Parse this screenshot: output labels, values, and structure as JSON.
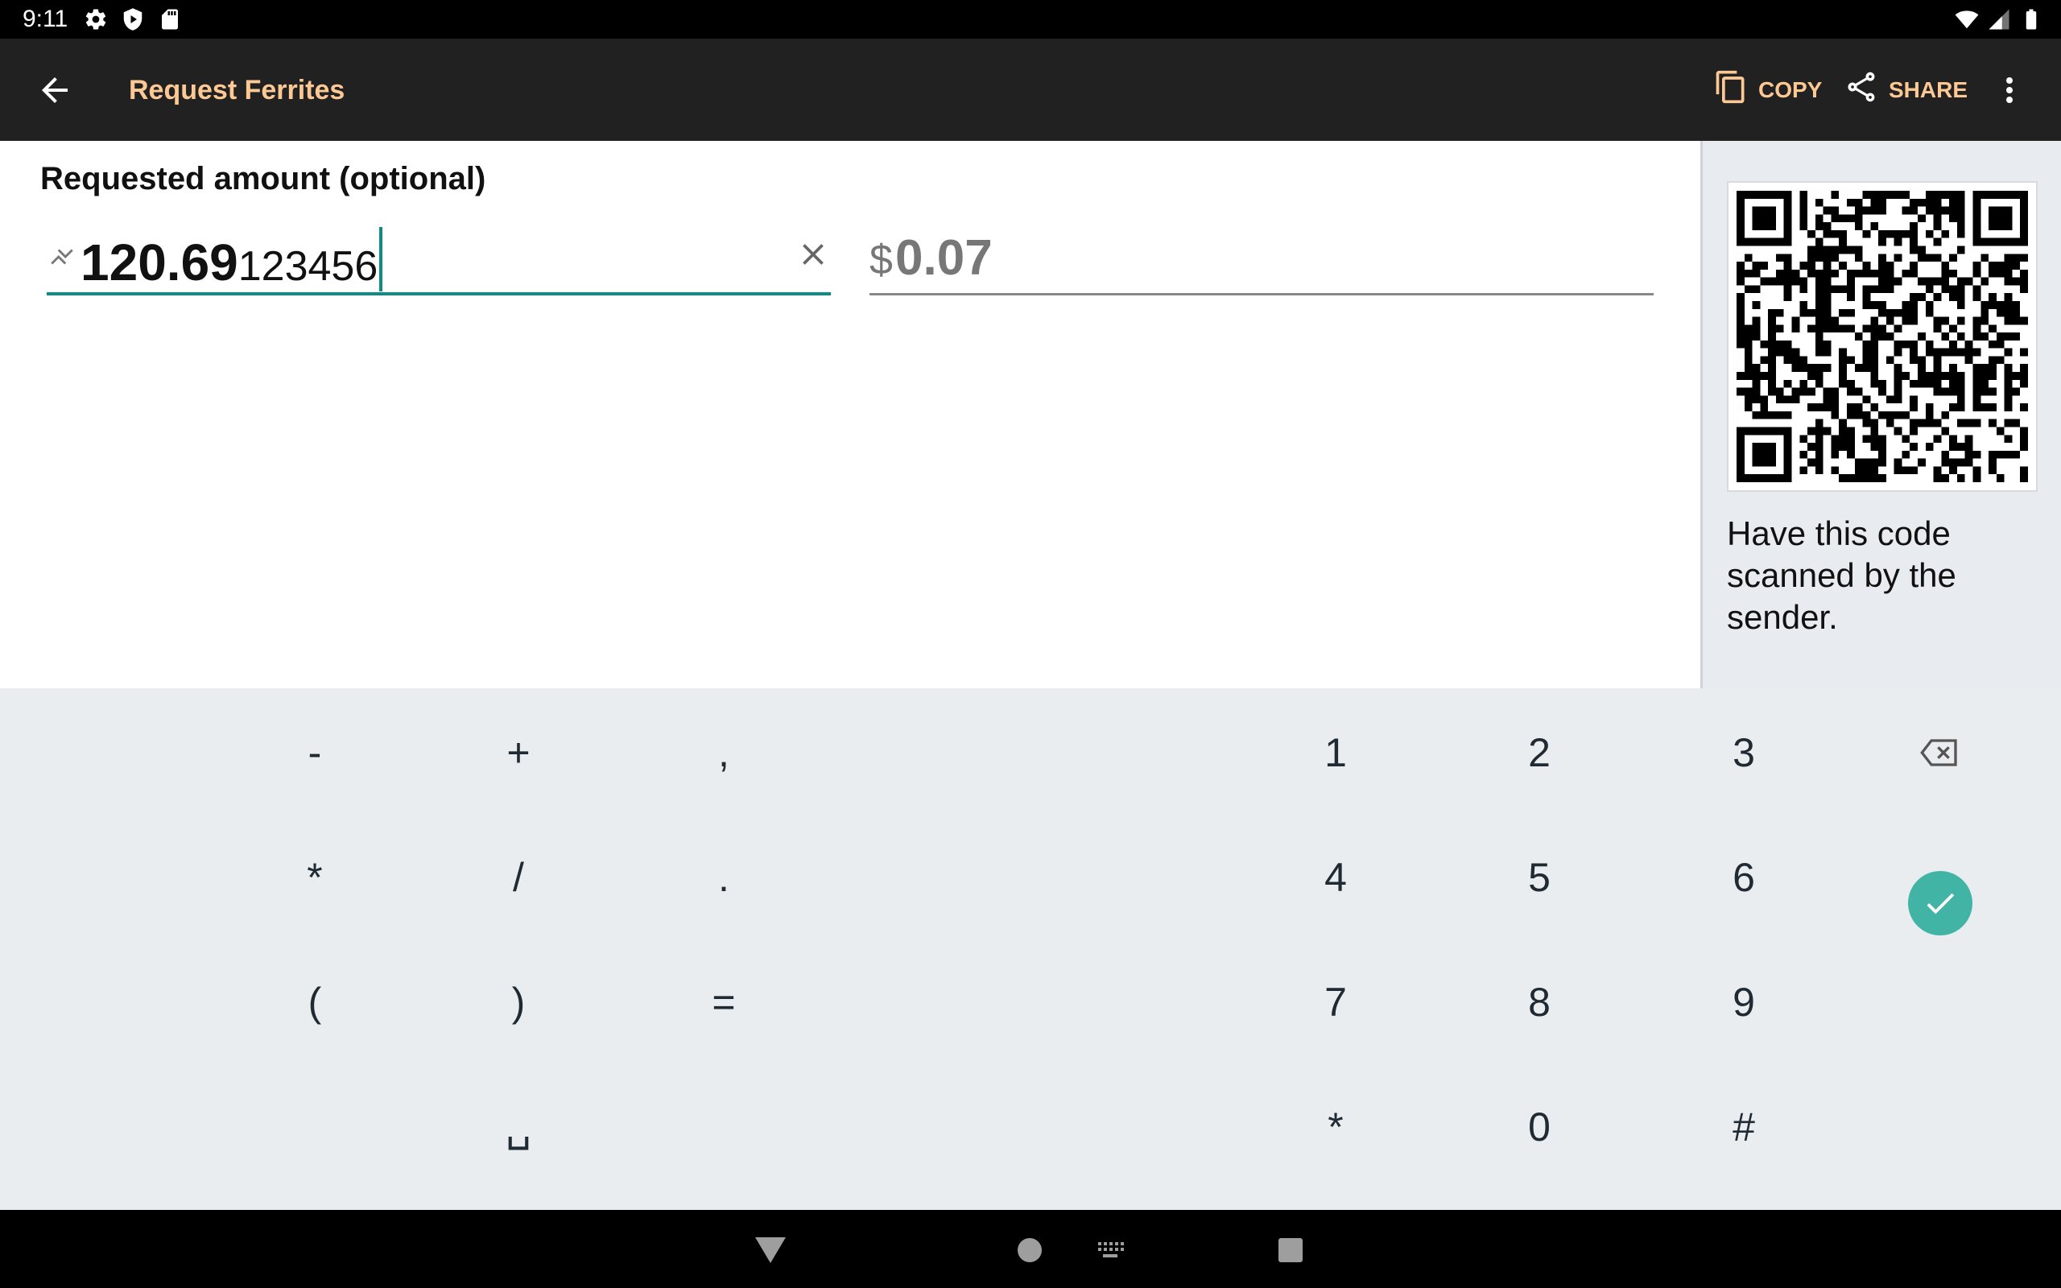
{
  "status_bar": {
    "time": "9:11",
    "left_icons": [
      "settings-icon",
      "shield-icon",
      "sd-card-icon"
    ],
    "right_icons": [
      "wifi-icon",
      "signal-icon",
      "battery-icon"
    ]
  },
  "app_bar": {
    "title": "Request Ferrites",
    "copy_label": "COPY",
    "share_label": "SHARE",
    "accent_color": "#fcc995",
    "background": "#212121"
  },
  "form": {
    "label": "Requested amount (optional)",
    "btc_amount_main": "120.69",
    "btc_amount_extra": "123456",
    "fiat_symbol": "$",
    "fiat_amount": "0.07",
    "focus_color": "#0f8c86"
  },
  "side_panel": {
    "qr_label": "QR code",
    "hint": "Have this code scanned by the sender."
  },
  "keyboard": {
    "symbols": [
      "-",
      "+",
      ",",
      "*",
      "/",
      ".",
      "(",
      ")",
      "=",
      "␣"
    ],
    "digits": [
      "1",
      "2",
      "3",
      "4",
      "5",
      "6",
      "7",
      "8",
      "9",
      "*",
      "0",
      "#"
    ],
    "backspace_icon": "backspace-icon",
    "enter_icon": "check-icon",
    "enter_color": "#42b4a6"
  },
  "nav_bar": {
    "icons": [
      "back-triangle-icon",
      "home-circle-icon",
      "keyboard-icon",
      "recents-square-icon"
    ]
  }
}
